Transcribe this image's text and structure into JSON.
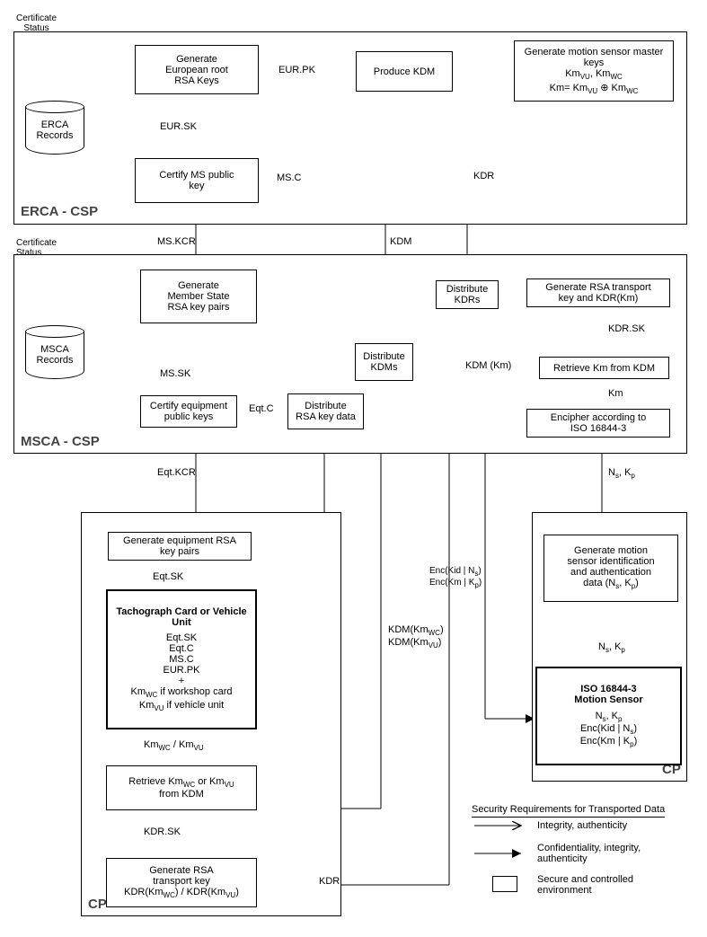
{
  "frames": {
    "erca": "ERCA - CSP",
    "msca": "MSCA - CSP",
    "cp_left": "CP",
    "cp_right": "CP"
  },
  "erca": {
    "certStatus": "Certificate\nStatus",
    "records": "ERCA\nRecords",
    "genRootKeys": "Generate\nEuropean root\nRSA Keys",
    "certifyMSKey": "Certify MS public\nkey",
    "produceKDM": "Produce KDM",
    "genMotionMaster": "Generate motion sensor master keys"
  },
  "msca": {
    "certStatus": "Certificate\nStatus",
    "records": "MSCA\nRecords",
    "genMSKeys": "Generate\nMember State\nRSA key pairs",
    "certifyEqKeys": "Certify equipment\npublic keys",
    "distributeKDRs": "Distribute\nKDRs",
    "distributeKDMs": "Distribute\nKDMs",
    "genRSATransport": "Generate RSA transport\nkey and KDR(Km)",
    "retrieveKm": "Retrieve Km from KDM",
    "distributeRSA": "Distribute\nRSA key data",
    "encipher": "Encipher according to\nISO 16844-3"
  },
  "cpLeft": {
    "genEqPairs": "Generate equipment RSA\nkey pairs",
    "tachoTitle": "Tachograph Card or\nVehicle Unit",
    "tachoBody": "Eqt.SK\nEqt.C\nMS.C\nEUR.PK\n+",
    "tachoBody2a": "Km",
    "tachoBody2b": " if workshop card",
    "tachoBody3a": "Km",
    "tachoBody3b": " if vehicle unit",
    "retrieveKm": " or Km",
    "retrieveKmPre": "Retrieve Km",
    "retrieveKmMid": "WC",
    "retrieveKmPost": "\nfrom KDM",
    "genRSATransport": "Generate RSA\ntransport key"
  },
  "cpRight": {
    "genMotionID": "Generate motion\nsensor identification\nand authentication\ndata (N",
    "genMotionIDEnd": ")",
    "isoTitle": "ISO 16844-3\nMotion Sensor"
  },
  "legend": {
    "title": "Security Requirements for Transported Data",
    "integrity": "Integrity, authenticity",
    "confidentiality": "Confidentiality, integrity,\nauthenticity",
    "secure": "Secure and controlled\nenvironment"
  },
  "edges": {
    "eurPk": "EUR.PK",
    "eurSk": "EUR.SK",
    "msC": "MS.C",
    "msKcr": "MS.KCR",
    "msSk": "MS.SK",
    "kdr": "KDR",
    "kdm": "KDM",
    "kdmKm": "KDM (Km)",
    "kdrSk": "KDR.SK",
    "km": "Km",
    "eqtKcr": "Eqt.KCR",
    "eqtSk": "Eqt.SK",
    "eqtC": "Eqt.C",
    "nsKp": "Nₛ, Kₚ",
    "rsaGroup": "Eqt.C\nMS.C\nEUR.PK"
  }
}
